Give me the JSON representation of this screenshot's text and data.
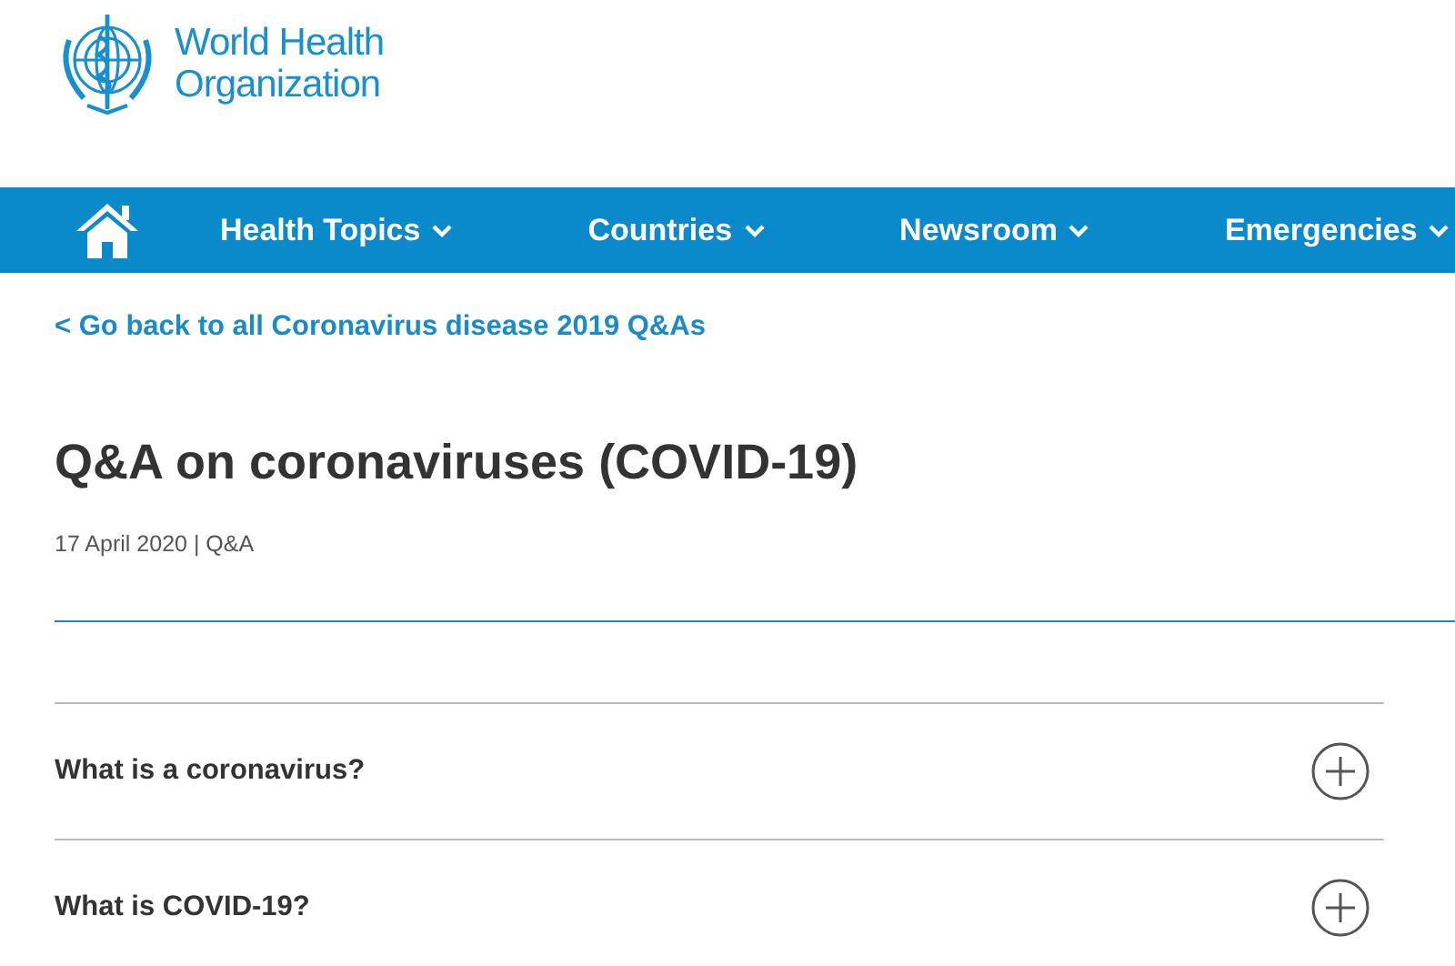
{
  "logo": {
    "line_1": "World Health",
    "line_2": "Organization"
  },
  "nav": {
    "items": [
      {
        "label": "Health Topics",
        "has_dropdown": true
      },
      {
        "label": "Countries",
        "has_dropdown": true
      },
      {
        "label": "Newsroom",
        "has_dropdown": true
      },
      {
        "label": "Emergencies",
        "has_dropdown": true
      }
    ]
  },
  "back_link": "< Go back to all Coronavirus disease 2019 Q&As",
  "title": "Q&A on coronaviruses (COVID-19)",
  "meta": "17 April 2020 | Q&A",
  "questions": [
    {
      "text": "What is a coronavirus?",
      "expanded": false
    },
    {
      "text": "What is COVID-19?",
      "expanded": false
    }
  ]
}
